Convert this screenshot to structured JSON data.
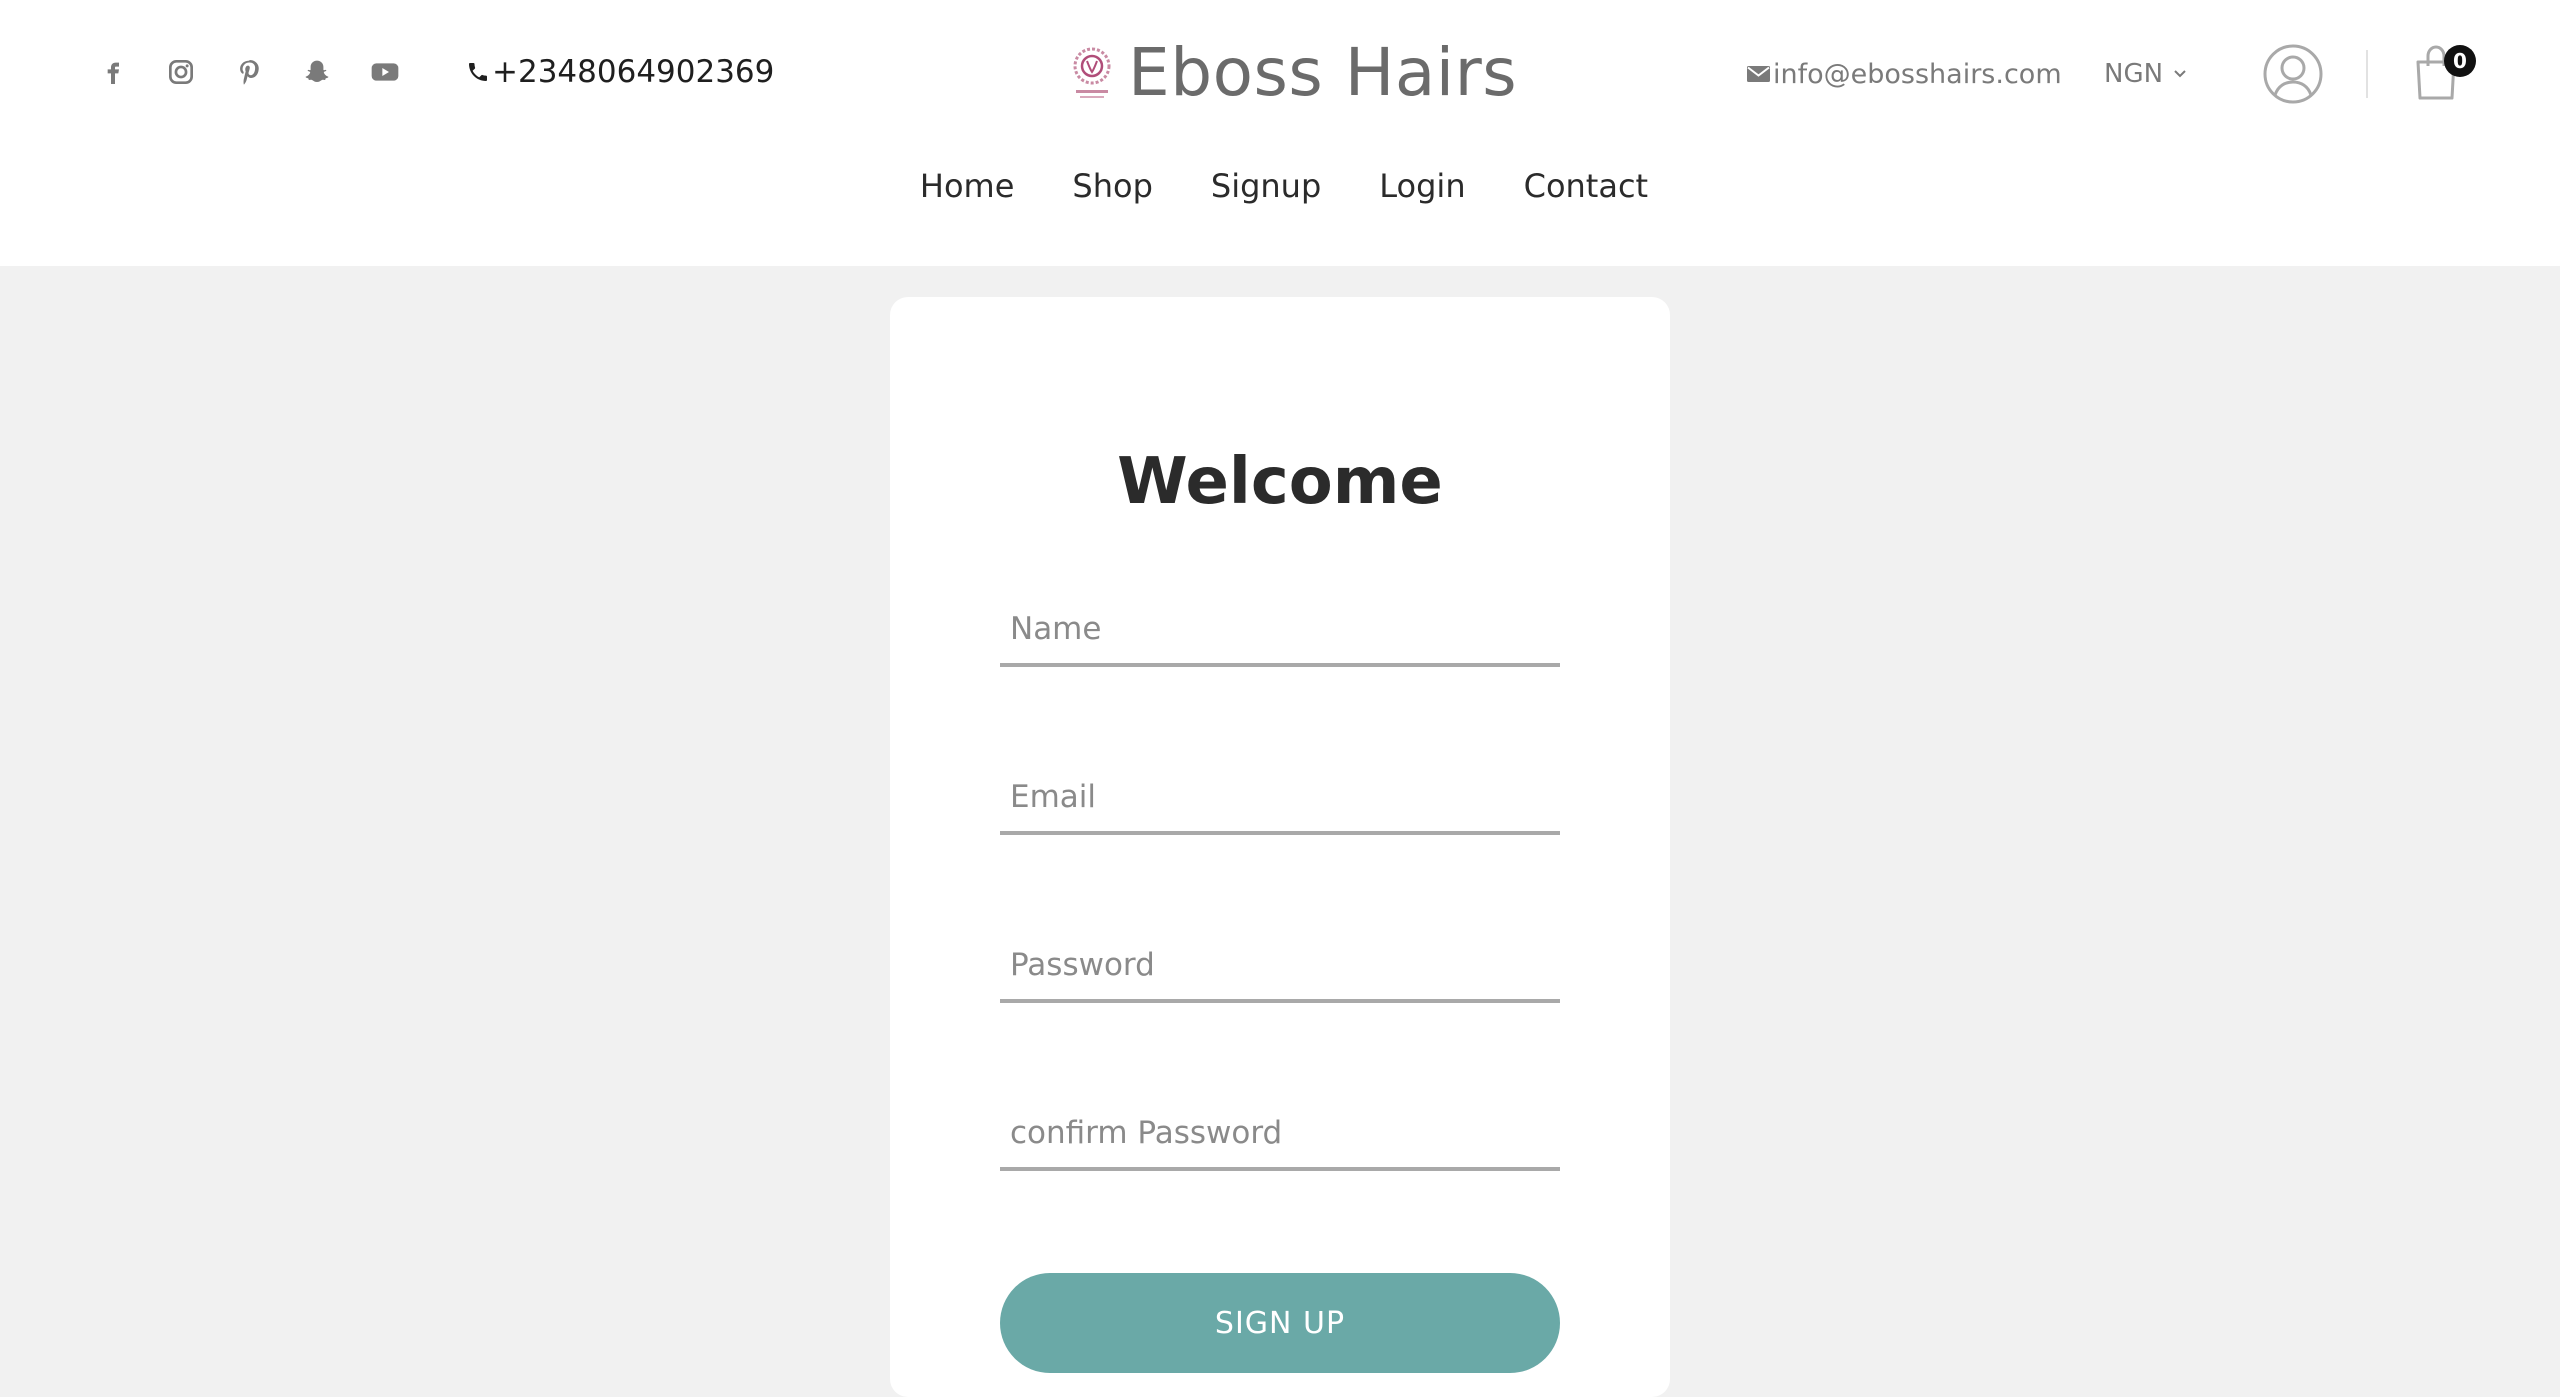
{
  "header": {
    "socials": [
      {
        "icon": "facebook-icon"
      },
      {
        "icon": "instagram-icon"
      },
      {
        "icon": "pinterest-icon"
      },
      {
        "icon": "snapchat-icon"
      },
      {
        "icon": "youtube-icon"
      }
    ],
    "phone": "+2348064902369",
    "brand": "Eboss Hairs",
    "email": "info@ebosshairs.com",
    "currency": "NGN",
    "cart_count": "0",
    "icon_color": "#7a7a7a"
  },
  "nav": {
    "home": "Home",
    "shop": "Shop",
    "signup": "Signup",
    "login": "Login",
    "contact": "Contact"
  },
  "form": {
    "title": "Welcome",
    "name_placeholder": "Name",
    "email_placeholder": "Email",
    "password_placeholder": "Password",
    "confirm_placeholder": "confirm Password",
    "submit_label": "SIGN UP",
    "button_color": "#6aa9a7"
  }
}
